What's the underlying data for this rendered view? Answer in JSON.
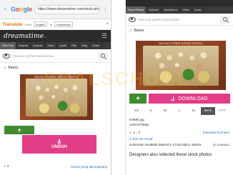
{
  "left": {
    "chrome": {
      "logo_letters": [
        "G",
        "o",
        "o",
        "g",
        "l",
        "e"
      ],
      "url": "https://www.dreamstime.com/stock-photography",
      "home_icon": "home-icon",
      "menu_icon": "more-vert-icon"
    },
    "translate": {
      "label": "Translate",
      "url": "https://www.translate.google.com/...",
      "from_label": "From",
      "from_value": "English",
      "to_label": "To",
      "to_value": "Indonesian",
      "close": "×"
    },
    "site": {
      "logo_main": "dreamstime",
      "logo_dot": ".",
      "tabs": [
        "Stok Foto",
        "Ilustrasi",
        "Ilustrasi",
        "Video",
        "Audio",
        "Fitur",
        "Blog",
        "Gratis"
      ],
      "search_placeholder": "Find your perfect stock photo.",
      "breadcrumb": "Bakso.",
      "photo_banner": "ROYALTY-FREE STOCK PHOTO",
      "plus_label": "+",
      "download_label": "UNDUH",
      "footer_left": "✓ 2",
      "footer_right": "Lisensi yang diperpanjang"
    }
  },
  "right": {
    "site": {
      "logo_main": "dreamstime",
      "logo_dot": ".",
      "tabs": [
        "Stock Photos",
        "Editorial",
        "Illustrations",
        "Video",
        "Audio"
      ],
      "search_placeholder": "Find your perfect stock photo.",
      "breadcrumb": "Bakso.",
      "photo_banner": "ROYALTY-FREE STOCK PHOTO",
      "plus_label": "+",
      "download_label": "DOWNLOAD",
      "sizes": [
        "XS",
        "S",
        "M",
        "L",
        "XL",
        "MAX",
        "TIFF"
      ],
      "active_size": "MAX",
      "file_size": "9.6MB jpg",
      "dimensions": "4297x2793px",
      "counts": "✓ 2   ↓ 2",
      "extended": "Extended licenses",
      "author_label": "© Erik De Graaf",
      "caption": "Indonesian meatballs (Bakso) in a food stall in Jakarta",
      "id_text": "ID 10904842",
      "also_text": "Designers also selected these stock photos"
    }
  },
  "watermark": "SOALSCHOOL",
  "colors": {
    "download": "#e23d86",
    "plus": "#3f8b2f",
    "header": "#2b2b2b"
  }
}
